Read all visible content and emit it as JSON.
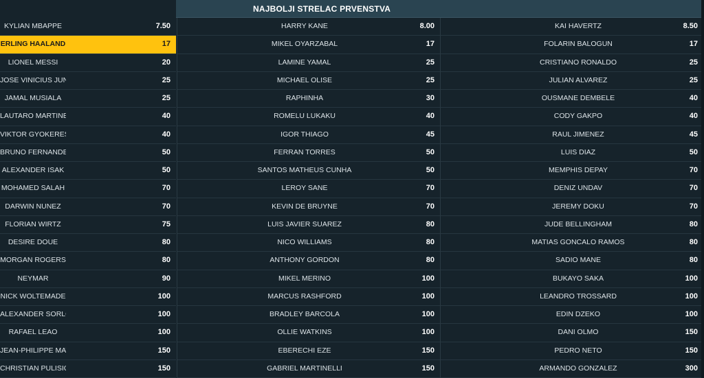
{
  "header": {
    "title": "NAJBOLJI STRELAC PRVENSTVA"
  },
  "selected": "ERLING HAALAND",
  "columns": [
    [
      {
        "name": "KYLIAN MBAPPE",
        "odd": "7.50"
      },
      {
        "name": "ERLING HAALAND",
        "odd": "17"
      },
      {
        "name": "LIONEL MESSI",
        "odd": "20"
      },
      {
        "name": "JOSE VINICIUS JUNIOR",
        "odd": "25"
      },
      {
        "name": "JAMAL MUSIALA",
        "odd": "25"
      },
      {
        "name": "LAUTARO MARTINEZ",
        "odd": "40"
      },
      {
        "name": "VIKTOR GYOKERES",
        "odd": "40"
      },
      {
        "name": "BRUNO FERNANDES",
        "odd": "50"
      },
      {
        "name": "ALEXANDER ISAK",
        "odd": "50"
      },
      {
        "name": "MOHAMED SALAH",
        "odd": "70"
      },
      {
        "name": "DARWIN NUNEZ",
        "odd": "70"
      },
      {
        "name": "FLORIAN WIRTZ",
        "odd": "75"
      },
      {
        "name": "DESIRE DOUE",
        "odd": "80"
      },
      {
        "name": "MORGAN ROGERS",
        "odd": "80"
      },
      {
        "name": "NEYMAR",
        "odd": "90"
      },
      {
        "name": "NICK WOLTEMADE",
        "odd": "100"
      },
      {
        "name": "ALEXANDER SORLOTH",
        "odd": "100"
      },
      {
        "name": "RAFAEL LEAO",
        "odd": "100"
      },
      {
        "name": "JEAN-PHILIPPE MATETA",
        "odd": "150"
      },
      {
        "name": "CHRISTIAN PULISIC",
        "odd": "150"
      }
    ],
    [
      {
        "name": "HARRY KANE",
        "odd": "8.00"
      },
      {
        "name": "MIKEL OYARZABAL",
        "odd": "17"
      },
      {
        "name": "LAMINE YAMAL",
        "odd": "25"
      },
      {
        "name": "MICHAEL OLISE",
        "odd": "25"
      },
      {
        "name": "RAPHINHA",
        "odd": "30"
      },
      {
        "name": "ROMELU LUKAKU",
        "odd": "40"
      },
      {
        "name": "IGOR THIAGO",
        "odd": "45"
      },
      {
        "name": "FERRAN TORRES",
        "odd": "50"
      },
      {
        "name": "SANTOS MATHEUS CUNHA",
        "odd": "50"
      },
      {
        "name": "LEROY SANE",
        "odd": "70"
      },
      {
        "name": "KEVIN DE BRUYNE",
        "odd": "70"
      },
      {
        "name": "LUIS JAVIER SUAREZ",
        "odd": "80"
      },
      {
        "name": "NICO WILLIAMS",
        "odd": "80"
      },
      {
        "name": "ANTHONY GORDON",
        "odd": "80"
      },
      {
        "name": "MIKEL MERINO",
        "odd": "100"
      },
      {
        "name": "MARCUS RASHFORD",
        "odd": "100"
      },
      {
        "name": "BRADLEY BARCOLA",
        "odd": "100"
      },
      {
        "name": "OLLIE WATKINS",
        "odd": "100"
      },
      {
        "name": "EBERECHI EZE",
        "odd": "150"
      },
      {
        "name": "GABRIEL MARTINELLI",
        "odd": "150"
      }
    ],
    [
      {
        "name": "KAI HAVERTZ",
        "odd": "8.50"
      },
      {
        "name": "FOLARIN BALOGUN",
        "odd": "17"
      },
      {
        "name": "CRISTIANO RONALDO",
        "odd": "25"
      },
      {
        "name": "JULIAN ALVAREZ",
        "odd": "25"
      },
      {
        "name": "OUSMANE DEMBELE",
        "odd": "40"
      },
      {
        "name": "CODY GAKPO",
        "odd": "40"
      },
      {
        "name": "RAUL JIMENEZ",
        "odd": "45"
      },
      {
        "name": "LUIS DIAZ",
        "odd": "50"
      },
      {
        "name": "MEMPHIS DEPAY",
        "odd": "70"
      },
      {
        "name": "DENIZ UNDAV",
        "odd": "70"
      },
      {
        "name": "JEREMY DOKU",
        "odd": "70"
      },
      {
        "name": "JUDE BELLINGHAM",
        "odd": "80"
      },
      {
        "name": "MATIAS GONCALO RAMOS",
        "odd": "80"
      },
      {
        "name": "SADIO MANE",
        "odd": "80"
      },
      {
        "name": "BUKAYO SAKA",
        "odd": "100"
      },
      {
        "name": "LEANDRO TROSSARD",
        "odd": "100"
      },
      {
        "name": "EDIN DZEKO",
        "odd": "100"
      },
      {
        "name": "DANI OLMO",
        "odd": "150"
      },
      {
        "name": "PEDRO NETO",
        "odd": "150"
      },
      {
        "name": "ARMANDO GONZALEZ",
        "odd": "300"
      }
    ]
  ],
  "colors": {
    "background": "#16232b",
    "header": "#2a4451",
    "selected": "#ffc20e",
    "text": "#dbe2e6"
  }
}
